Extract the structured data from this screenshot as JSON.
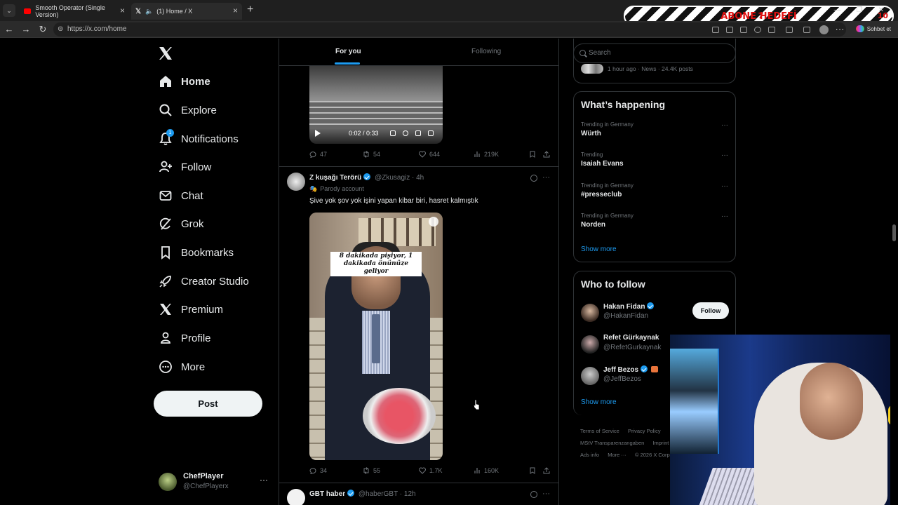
{
  "browser": {
    "tabs": [
      {
        "title": "Smooth Operator (Single Version)",
        "favicon": "youtube-icon"
      },
      {
        "title": "(1) Home / X",
        "favicon": "x-logo-icon",
        "active": true
      }
    ],
    "url": "https://x.com/home",
    "sohbet_label": "Sohbet et",
    "overlay_banner": "ABONE HEDEFİ",
    "overlay_left_num": "7",
    "overlay_right_num": "10"
  },
  "nav": {
    "items": [
      {
        "label": "Home",
        "icon": "home-icon"
      },
      {
        "label": "Explore",
        "icon": "search-icon"
      },
      {
        "label": "Notifications",
        "icon": "bell-icon",
        "badge": "1"
      },
      {
        "label": "Follow",
        "icon": "person-plus-icon"
      },
      {
        "label": "Chat",
        "icon": "envelope-icon"
      },
      {
        "label": "Grok",
        "icon": "grok-icon"
      },
      {
        "label": "Bookmarks",
        "icon": "bookmark-icon"
      },
      {
        "label": "Creator Studio",
        "icon": "rocket-icon"
      },
      {
        "label": "Premium",
        "icon": "x-logo-icon"
      },
      {
        "label": "Profile",
        "icon": "person-icon"
      },
      {
        "label": "More",
        "icon": "more-circle-icon"
      }
    ],
    "post_label": "Post",
    "profile": {
      "name": "ChefPlayer",
      "handle": "@ChefPlayerx",
      "more": "···"
    }
  },
  "timeline": {
    "tabs": {
      "for_you": "For you",
      "following": "Following"
    },
    "video1": {
      "time": "0:02 / 0:33"
    },
    "tweet1_actions": {
      "replies": "47",
      "reposts": "54",
      "likes": "644",
      "views": "219K"
    },
    "tweet2": {
      "name": "Z kuşağı Terörü",
      "handle": "@Zkusagiz",
      "time": "· 4h",
      "parody": "Parody account",
      "text": "Şive yok şov yok işini yapan kibar biri, hasret kalmıştık",
      "caption_line1": "8 dakikada pişiyor, 1",
      "caption_line2": "dakikada önünüze geliyor",
      "replies": "34",
      "reposts": "55",
      "likes": "1.7K",
      "views": "160K"
    },
    "tweet3": {
      "name": "GBT haber",
      "handle": "@haberGBT",
      "time": "· 12h"
    }
  },
  "sidebar": {
    "search_placeholder": "Search",
    "news_meta": "1 hour ago · News · 24.4K posts",
    "whats_happening_title": "What’s happening",
    "trends": [
      {
        "context": "Trending in Germany",
        "name": "Würth"
      },
      {
        "context": "Trending",
        "name": "Isaiah Evans"
      },
      {
        "context": "Trending in Germany",
        "name": "#presseclub"
      },
      {
        "context": "Trending in Germany",
        "name": "Norden"
      }
    ],
    "show_more": "Show more",
    "who_to_follow_title": "Who to follow",
    "follow_suggestions": [
      {
        "name": "Hakan Fidan",
        "handle": "@HakanFidan",
        "verified": true,
        "button": "Follow"
      },
      {
        "name": "Refet Gürkaynak",
        "handle": "@RefetGurkaynak",
        "verified": false
      },
      {
        "name": "Jeff Bezos",
        "handle": "@JeffBezos",
        "verified": true
      }
    ],
    "show_more_follow": "Show more",
    "footer": {
      "terms": "Terms of Service",
      "privacy": "Privacy Policy",
      "msv": "MStV Transparenzangaben",
      "imprint": "Imprint",
      "ads": "Ads info",
      "more": "More ···",
      "copyright": "© 2026 X Corp."
    }
  },
  "colors": {
    "accent": "#1d9bf0",
    "background": "#000000",
    "border": "#2f3336",
    "muted": "#71767b"
  }
}
